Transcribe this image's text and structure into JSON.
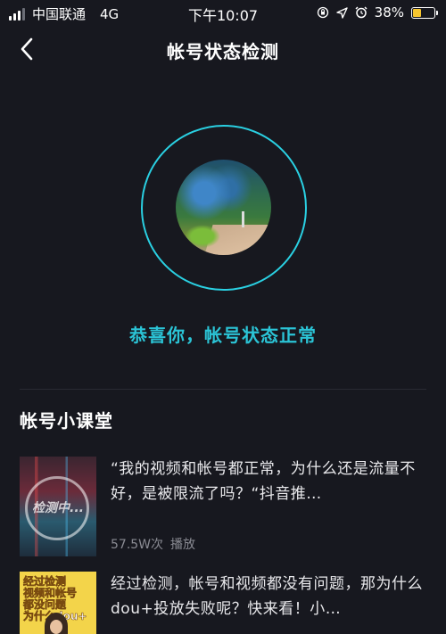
{
  "status_bar": {
    "carrier": "中国联通",
    "network": "4G",
    "time": "下午10:07",
    "battery_percent": "38%",
    "battery_level": 0.38,
    "icons": [
      "signal-icon",
      "orientation-lock-icon",
      "location-icon",
      "alarm-icon",
      "battery-icon"
    ]
  },
  "nav": {
    "title": "帐号状态检测",
    "back_icon": "chevron-left-icon"
  },
  "check": {
    "result": "恭喜你，帐号状态正常"
  },
  "lessons": {
    "section_title": "帐号小课堂",
    "items": [
      {
        "title": "“我的视频和帐号都正常，为什么还是流量不好，是被限流了吗？“抖音推…",
        "views": "57.5W次",
        "views_label": "播放",
        "thumb_text": "检测中..."
      },
      {
        "title": "经过检测，帐号和视频都没有问题，那为什么dou+投放失败呢？快来看！小…",
        "thumb_lines": [
          "经过检测",
          "视频和帐号",
          "都没问题",
          "为什么dou+"
        ]
      }
    ]
  },
  "colors": {
    "background": "#17181f",
    "accent": "#2bc4d6",
    "battery": "#f7c62f"
  }
}
